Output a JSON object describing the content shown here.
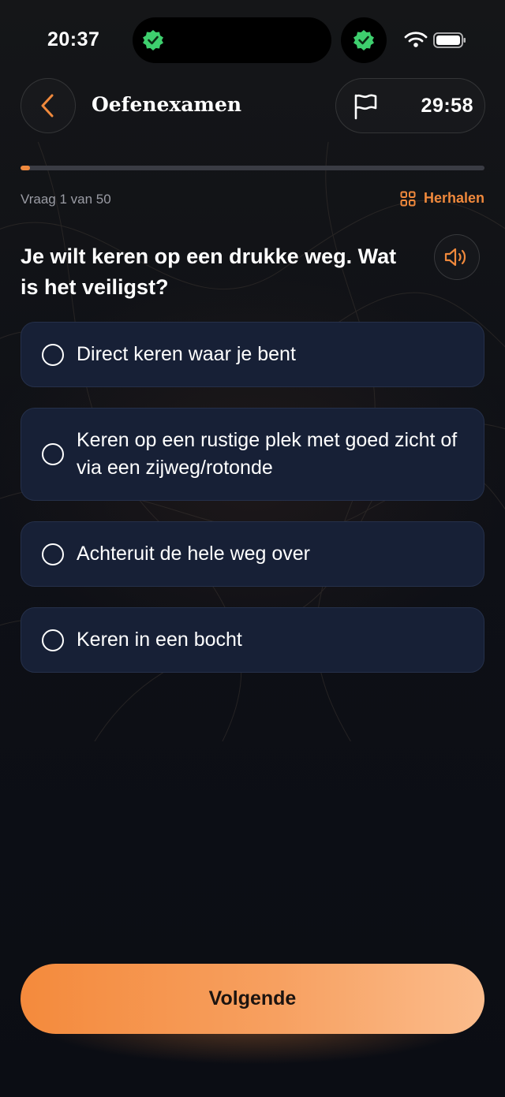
{
  "status_bar": {
    "time": "20:37"
  },
  "header": {
    "title": "Oefenexamen",
    "timer": "29:58"
  },
  "progress": {
    "fraction": 0.02,
    "counter_text": "Vraag 1 van 50",
    "repeat_label": "Herhalen"
  },
  "question": {
    "text": "Je wilt keren op een drukke weg. Wat is het veiligst?"
  },
  "options": [
    {
      "label": "Direct keren waar je bent"
    },
    {
      "label": "Keren op een rustige plek met goed zicht of via een zijweg/rotonde"
    },
    {
      "label": "Achteruit de hele weg over"
    },
    {
      "label": "Keren in een bocht"
    }
  ],
  "footer": {
    "next_label": "Volgende"
  },
  "colors": {
    "accent": "#f0893c",
    "option_bg": "#172036",
    "verify_green": "#3ecf6e"
  },
  "icons": [
    "chevron-left-icon",
    "flag-icon",
    "grid-icon",
    "speaker-icon",
    "verified-badge-icon",
    "wifi-icon",
    "battery-icon"
  ]
}
